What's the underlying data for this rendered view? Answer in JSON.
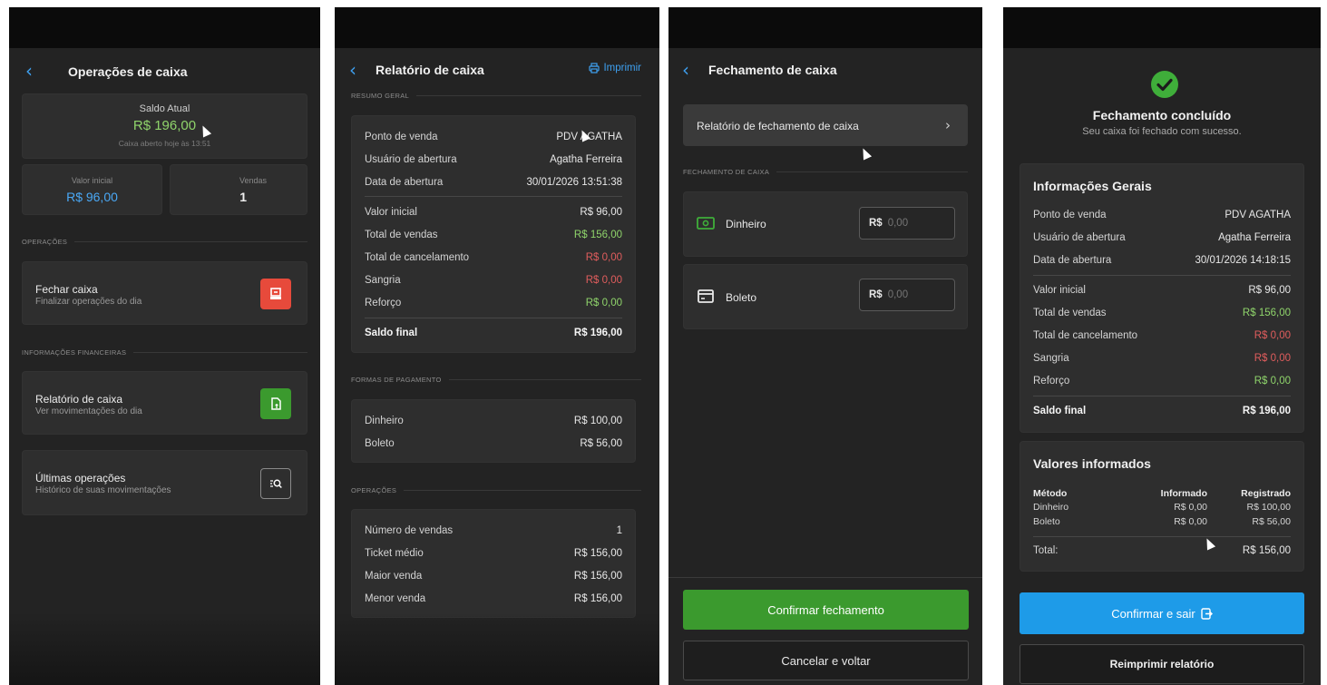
{
  "colors": {
    "accent": "#3ea0f0",
    "positive": "#8fd46b",
    "negative": "#e05d5d",
    "confirm_green": "#3b9a2e",
    "confirm_blue": "#1e9be8",
    "danger": "#e74a3b"
  },
  "s1": {
    "title": "Operações de caixa",
    "saldo_label": "Saldo Atual",
    "saldo_value": "R$ 196,00",
    "saldo_sub": "Caixa aberto hoje às 13:51",
    "valor_inicial_label": "Valor inicial",
    "valor_inicial_value": "R$ 96,00",
    "vendas_label": "Vendas",
    "vendas_value": "1",
    "section_operacoes": "OPERAÇÕES",
    "fechar_title": "Fechar caixa",
    "fechar_sub": "Finalizar operações do dia",
    "section_info": "INFORMAÇÕES FINANCEIRAS",
    "relatorio_title": "Relatório de caixa",
    "relatorio_sub": "Ver movimentações do dia",
    "ultimas_title": "Últimas operações",
    "ultimas_sub": "Histórico de suas movimentações"
  },
  "s2": {
    "title": "Relatório de caixa",
    "print_label": "Imprimir",
    "section_resumo": "RESUMO GERAL",
    "resumo": [
      {
        "label": "Ponto de venda",
        "value": "PDV AGATHA"
      },
      {
        "label": "Usuário de abertura",
        "value": "Agatha Ferreira"
      },
      {
        "label": "Data de abertura",
        "value": "30/01/2026 13:51:38"
      },
      {
        "label": "Valor inicial",
        "value": "R$ 96,00"
      },
      {
        "label": "Total de vendas",
        "value": "R$ 156,00"
      },
      {
        "label": "Total de cancelamento",
        "value": "R$ 0,00"
      },
      {
        "label": "Sangria",
        "value": "R$ 0,00"
      },
      {
        "label": "Reforço",
        "value": "R$ 0,00"
      }
    ],
    "saldo_final_label": "Saldo final",
    "saldo_final_value": "R$ 196,00",
    "section_pagamento": "FORMAS DE PAGAMENTO",
    "pagamentos": [
      {
        "label": "Dinheiro",
        "value": "R$ 100,00"
      },
      {
        "label": "Boleto",
        "value": "R$ 56,00"
      }
    ],
    "section_operacoes": "OPERAÇÕES",
    "operacoes": [
      {
        "label": "Número de vendas",
        "value": "1"
      },
      {
        "label": "Ticket médio",
        "value": "R$ 156,00"
      },
      {
        "label": "Maior venda",
        "value": "R$ 156,00"
      },
      {
        "label": "Menor venda",
        "value": "R$ 156,00"
      }
    ]
  },
  "s3": {
    "title": "Fechamento de caixa",
    "relatorio_link": "Relatório de fechamento de caixa",
    "section_fechamento": "FECHAMENTO DE CAIXA",
    "dinheiro_label": "Dinheiro",
    "boleto_label": "Boleto",
    "currency": "R$",
    "input_placeholder": "0,00",
    "confirm_label": "Confirmar fechamento",
    "cancel_label": "Cancelar e voltar"
  },
  "s4": {
    "title": "Fechamento concluído",
    "subtitle": "Seu caixa foi fechado com sucesso.",
    "info_title": "Informações Gerais",
    "info": [
      {
        "label": "Ponto de venda",
        "value": "PDV AGATHA"
      },
      {
        "label": "Usuário de abertura",
        "value": "Agatha Ferreira"
      },
      {
        "label": "Data de abertura",
        "value": "30/01/2026 14:18:15"
      },
      {
        "label": "Valor inicial",
        "value": "R$ 96,00"
      },
      {
        "label": "Total de vendas",
        "value": "R$ 156,00"
      },
      {
        "label": "Total de cancelamento",
        "value": "R$ 0,00"
      },
      {
        "label": "Sangria",
        "value": "R$ 0,00"
      },
      {
        "label": "Reforço",
        "value": "R$ 0,00"
      }
    ],
    "saldo_final_label": "Saldo final",
    "saldo_final_value": "R$ 196,00",
    "valores_title": "Valores informados",
    "col_metodo": "Método",
    "col_informado": "Informado",
    "col_registrado": "Registrado",
    "valores": [
      {
        "metodo": "Dinheiro",
        "informado": "R$ 0,00",
        "registrado": "R$ 100,00"
      },
      {
        "metodo": "Boleto",
        "informado": "R$ 0,00",
        "registrado": "R$ 56,00"
      }
    ],
    "total_label": "Total:",
    "total_value": "R$ 156,00",
    "confirm_label": "Confirmar e sair",
    "reprint_label": "Reimprimir relatório"
  }
}
